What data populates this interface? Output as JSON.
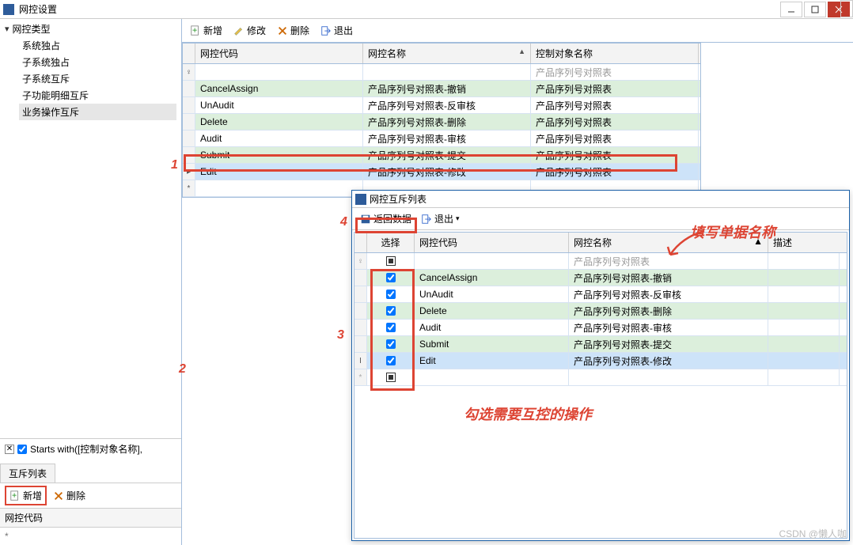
{
  "window": {
    "title": "网控设置"
  },
  "tree": {
    "root": "网控类型",
    "items": [
      "系统独占",
      "子系统独占",
      "子系统互斥",
      "子功能明细互斥",
      "业务操作互斥"
    ],
    "selected_index": 4
  },
  "toolbar": {
    "add": "新增",
    "edit": "修改",
    "delete": "删除",
    "exit": "退出"
  },
  "grid": {
    "cols": [
      "网控代码",
      "网控名称",
      "控制对象名称"
    ],
    "filter_row": [
      "",
      "",
      "产品序列号对照表"
    ],
    "rows": [
      {
        "code": "CancelAssign",
        "name": "产品序列号对照表-撤销",
        "target": "产品序列号对照表",
        "alt": "green"
      },
      {
        "code": "UnAudit",
        "name": "产品序列号对照表-反审核",
        "target": "产品序列号对照表",
        "alt": "white"
      },
      {
        "code": "Delete",
        "name": "产品序列号对照表-删除",
        "target": "产品序列号对照表",
        "alt": "green"
      },
      {
        "code": "Audit",
        "name": "产品序列号对照表-审核",
        "target": "产品序列号对照表",
        "alt": "white"
      },
      {
        "code": "Submit",
        "name": "产品序列号对照表-提交",
        "target": "产品序列号对照表",
        "alt": "green"
      },
      {
        "code": "Edit",
        "name": "产品序列号对照表-修改",
        "target": "产品序列号对照表",
        "alt": "sel"
      }
    ]
  },
  "filter_text": "Starts with([控制对象名称],",
  "bottom_tab": {
    "title": "互斥列表",
    "add": "新增",
    "delete": "删除",
    "col": "网控代码",
    "newrow": "*"
  },
  "popup": {
    "title": "网控互斥列表",
    "toolbar": {
      "save": "返回数据",
      "exit": "退出"
    },
    "cols": [
      "选择",
      "网控代码",
      "网控名称",
      "描述"
    ],
    "filter_name": "产品序列号对照表",
    "rows": [
      {
        "checked": true,
        "code": "CancelAssign",
        "name": "产品序列号对照表-撤销",
        "alt": "green"
      },
      {
        "checked": true,
        "code": "UnAudit",
        "name": "产品序列号对照表-反审核",
        "alt": "white"
      },
      {
        "checked": true,
        "code": "Delete",
        "name": "产品序列号对照表-删除",
        "alt": "green"
      },
      {
        "checked": true,
        "code": "Audit",
        "name": "产品序列号对照表-审核",
        "alt": "white"
      },
      {
        "checked": true,
        "code": "Submit",
        "name": "产品序列号对照表-提交",
        "alt": "green"
      },
      {
        "checked": true,
        "code": "Edit",
        "name": "产品序列号对照表-修改",
        "alt": "sel"
      }
    ]
  },
  "annotations": {
    "n1": "1",
    "n2": "2",
    "n3": "3",
    "n4": "4",
    "fill_name": "填写单据名称",
    "check_ops": "勾选需要互控的操作"
  },
  "watermark": "CSDN @懒人咖"
}
